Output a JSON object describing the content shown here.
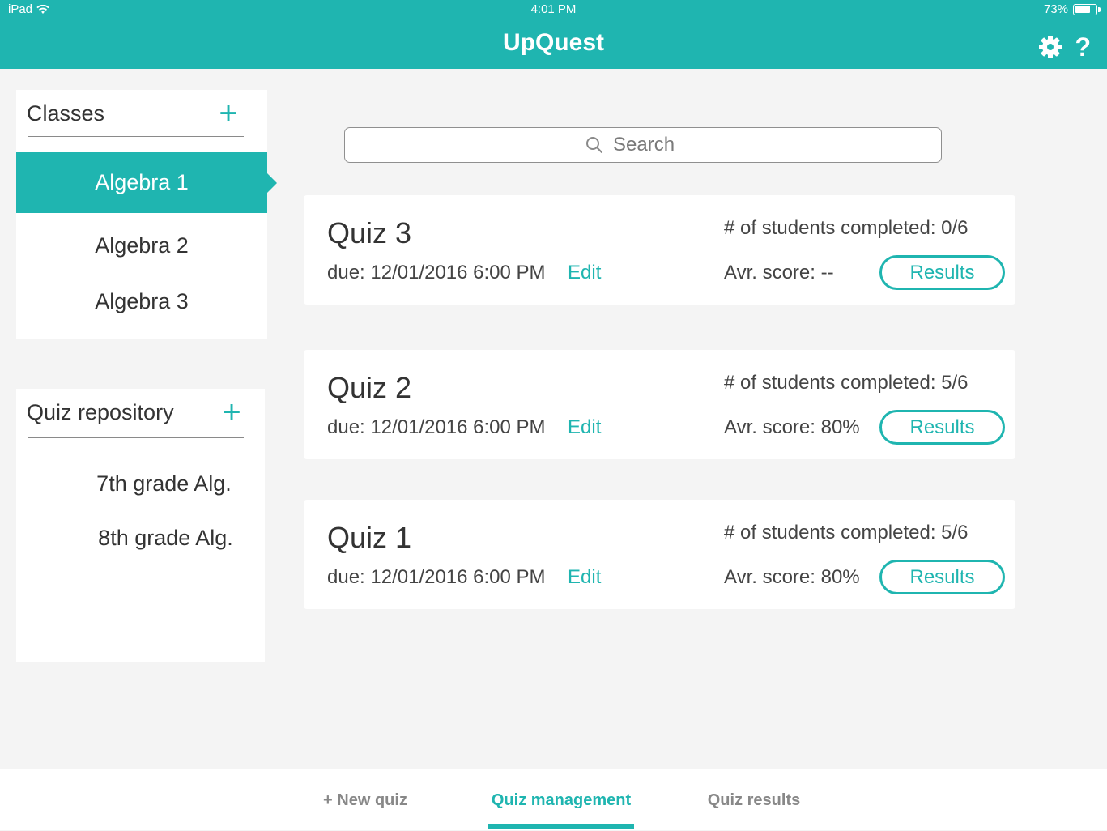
{
  "status_bar": {
    "device": "iPad",
    "time": "4:01 PM",
    "battery": "73%",
    "battery_level": 0.73
  },
  "header": {
    "title": "UpQuest",
    "icons": [
      "gear-icon",
      "help-icon"
    ],
    "help_glyph": "?"
  },
  "classes": {
    "title": "Classes",
    "add_glyph": "+",
    "items": [
      {
        "label": "Algebra 1",
        "selected": true
      },
      {
        "label": "Algebra 2",
        "selected": false
      },
      {
        "label": "Algebra 3",
        "selected": false
      }
    ]
  },
  "quiz_repository": {
    "title": "Quiz repository",
    "add_glyph": "+",
    "items": [
      {
        "label": "7th grade Alg."
      },
      {
        "label": "8th grade Alg."
      }
    ]
  },
  "search": {
    "placeholder": "Search"
  },
  "quizzes": [
    {
      "name": "Quiz 3",
      "due": "due: 12/01/2016 6:00 PM",
      "edit_label": "Edit",
      "completed": "# of students completed: 0/6",
      "avg_score": "Avr. score: --",
      "results_label": "Results"
    },
    {
      "name": "Quiz 2",
      "due": "due: 12/01/2016 6:00 PM",
      "edit_label": "Edit",
      "completed": "# of students completed: 5/6",
      "avg_score": "Avr. score: 80%",
      "results_label": "Results"
    },
    {
      "name": "Quiz 1",
      "due": "due: 12/01/2016 6:00 PM",
      "edit_label": "Edit",
      "completed": "# of students completed: 5/6",
      "avg_score": "Avr. score: 80%",
      "results_label": "Results"
    }
  ],
  "tabs": [
    {
      "label": "+ New quiz",
      "active": false
    },
    {
      "label": "Quiz management",
      "active": true
    },
    {
      "label": "Quiz results",
      "active": false
    }
  ],
  "colors": {
    "accent": "#1fb5b0",
    "background": "#f4f4f4"
  }
}
